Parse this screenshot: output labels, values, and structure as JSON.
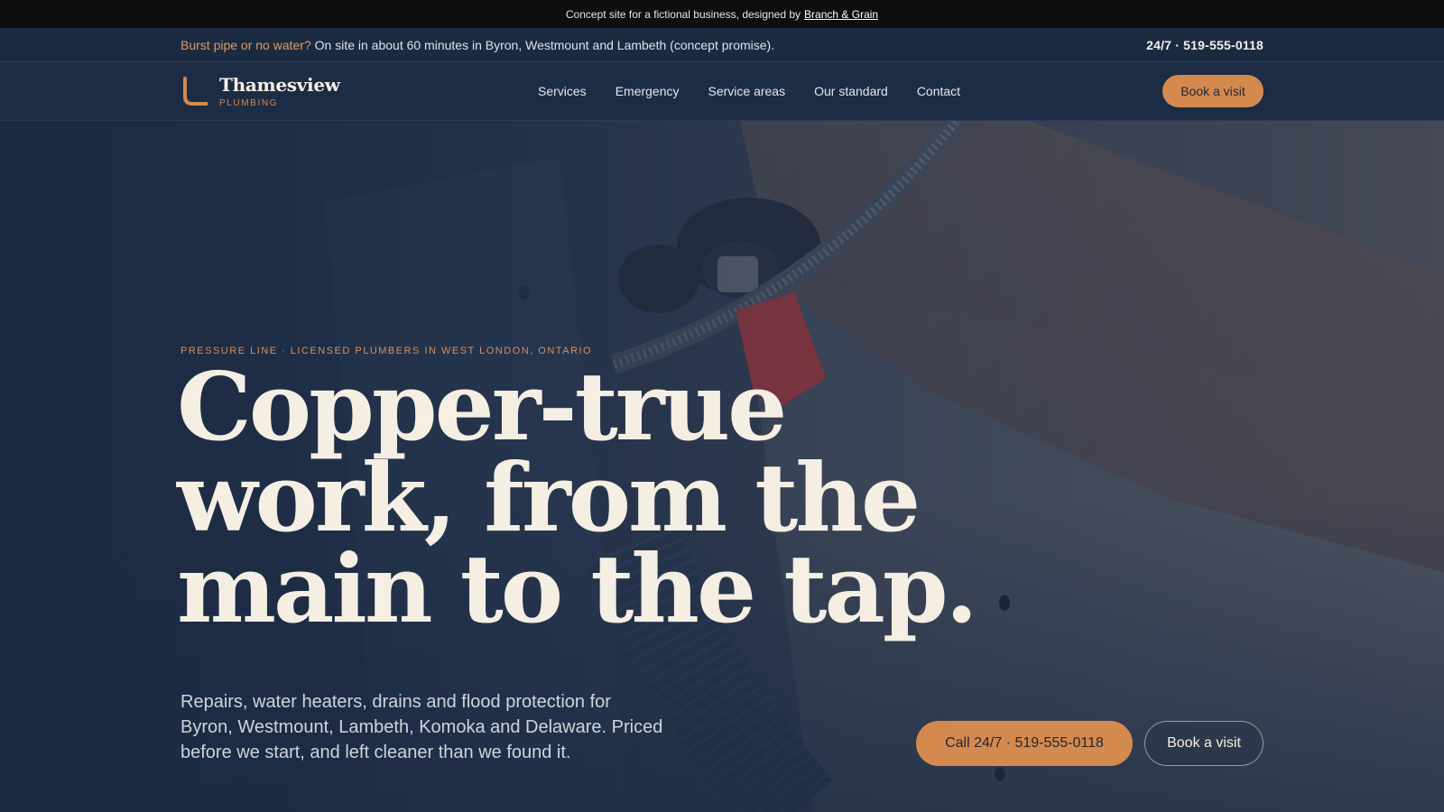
{
  "concept_bar": {
    "text": "Concept site for a fictional business, designed by",
    "link_label": "Branch & Grain"
  },
  "alert_bar": {
    "lead": "Burst pipe or no water?",
    "message": "On site in about 60 minutes in Byron, Westmount and Lambeth (concept promise).",
    "phone": "24/7 · 519-555-0118"
  },
  "brand": {
    "name": "Thamesview",
    "sub": "PLUMBING",
    "icon": "pipe-elbow-icon"
  },
  "nav": {
    "items": [
      {
        "label": "Services"
      },
      {
        "label": "Emergency"
      },
      {
        "label": "Service areas"
      },
      {
        "label": "Our standard"
      },
      {
        "label": "Contact"
      }
    ],
    "cta_label": "Book a visit"
  },
  "hero": {
    "eyebrow": "PRESSURE LINE · LICENSED PLUMBERS IN WEST LONDON, ONTARIO",
    "headline_lines": [
      "Copper-true",
      "work, from the",
      "main to the tap."
    ],
    "lede": "Repairs, water heaters, drains and flood protection for Byron, Westmount, Lambeth, Komoka and Delaware. Priced before we start, and left cleaner than we found it.",
    "call_label": "Call 24/7 · 519-555-0118",
    "book_label": "Book a visit",
    "background_image": "hand-tightening-pipe-fitting-photo"
  },
  "colors": {
    "accent": "#d48a4e",
    "navy": "#1c2c44",
    "cream": "#f4eee3",
    "concept_bg": "#0d0e10"
  }
}
